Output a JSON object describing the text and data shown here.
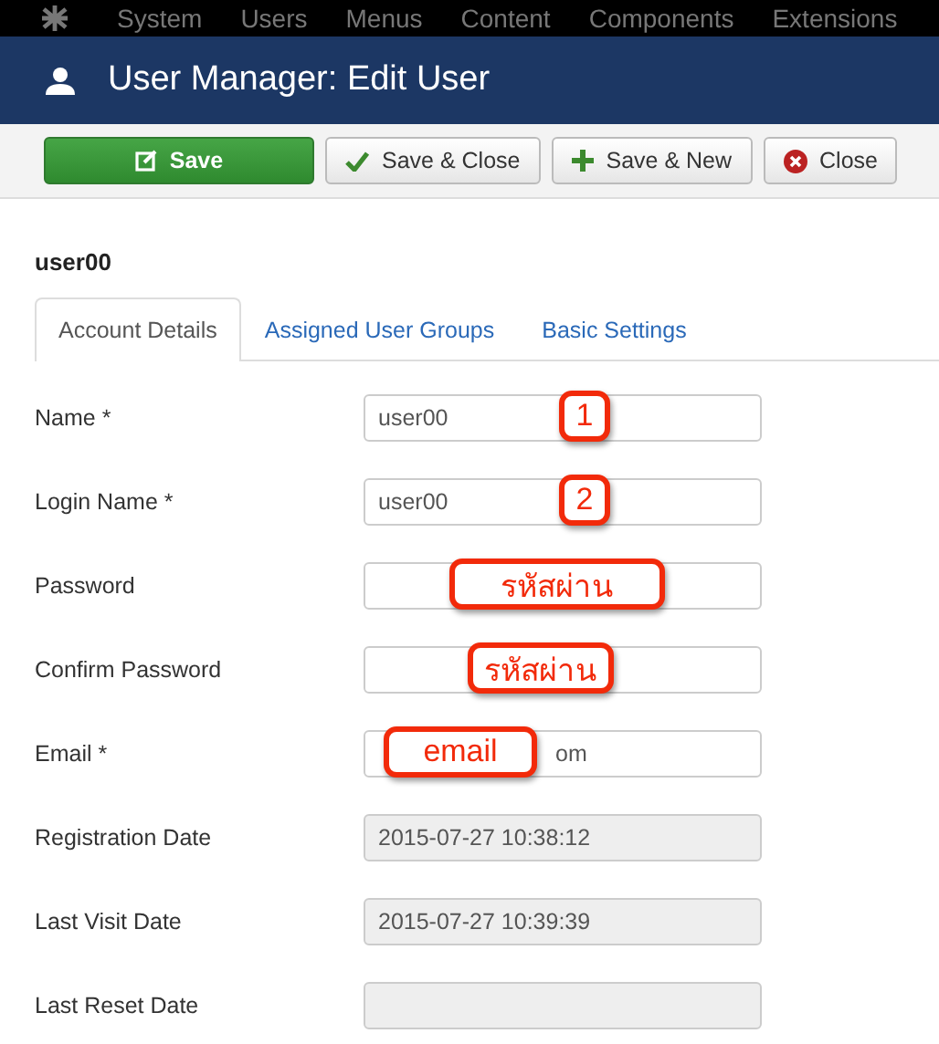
{
  "top_menu": [
    "System",
    "Users",
    "Menus",
    "Content",
    "Components",
    "Extensions"
  ],
  "header": {
    "title": "User Manager: Edit User"
  },
  "toolbar": [
    {
      "label": "Save",
      "kind": "primary"
    },
    {
      "label": "Save & Close",
      "kind": "check"
    },
    {
      "label": "Save & New",
      "kind": "plus"
    },
    {
      "label": "Close",
      "kind": "close"
    }
  ],
  "record_title": "user00",
  "tabs": [
    {
      "label": "Account Details",
      "selected": true
    },
    {
      "label": "Assigned User Groups",
      "selected": false
    },
    {
      "label": "Basic Settings",
      "selected": false
    }
  ],
  "fields": [
    {
      "label": "Name *",
      "value": "user00",
      "disabled": false,
      "callout": "1"
    },
    {
      "label": "Login Name *",
      "value": "user00",
      "disabled": false,
      "callout": "2"
    },
    {
      "label": "Password",
      "disabled": false,
      "callout": "รหัสผ่าน"
    },
    {
      "label": "Confirm Password",
      "disabled": false,
      "callout": "รหัสผ่าน"
    },
    {
      "label": "Email *",
      "callout": "email",
      "value_end": "om",
      "disabled": false
    },
    {
      "label": "Registration Date",
      "value": "2015-07-27 10:38:12",
      "disabled": true
    },
    {
      "label": "Last Visit Date",
      "value": "2015-07-27 10:39:39",
      "disabled": true
    },
    {
      "label": "Last Reset Date",
      "disabled": true
    }
  ]
}
